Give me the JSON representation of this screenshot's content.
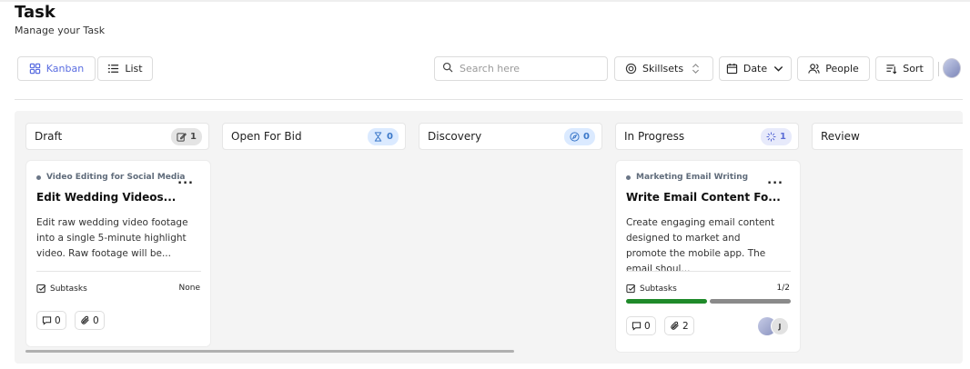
{
  "header": {
    "title": "Task",
    "subtitle": "Manage your Task"
  },
  "views": {
    "kanban_label": "Kanban",
    "list_label": "List",
    "active": "Kanban"
  },
  "toolbar": {
    "search_placeholder": "Search here",
    "skillsets_label": "Skillsets",
    "date_label": "Date",
    "people_label": "People",
    "sort_label": "Sort"
  },
  "columns": [
    {
      "name": "Draft",
      "count": "1",
      "badge_icon": "edit-icon"
    },
    {
      "name": "Open For Bid",
      "count": "0",
      "badge_icon": "hourglass-icon"
    },
    {
      "name": "Discovery",
      "count": "0",
      "badge_icon": "compass-icon"
    },
    {
      "name": "In Progress",
      "count": "1",
      "badge_icon": "loader-icon"
    },
    {
      "name": "Review"
    }
  ],
  "cards": {
    "draft": {
      "category": "Video Editing for Social Media",
      "title": "Edit Wedding Videos...",
      "description": "Edit raw wedding video footage into a single 5-minute highlight video. Raw footage will be...",
      "subtasks_label": "Subtasks",
      "subtasks_value": "None",
      "comments": "0",
      "attachments": "0"
    },
    "in_progress": {
      "category": "Marketing Email Writing",
      "title": "Write Email Content Fo...",
      "description": "Create engaging email content designed to market and promote the mobile app. The email shoul...",
      "subtasks_label": "Subtasks",
      "subtasks_value": "1/2",
      "subtasks_progress": 0.5,
      "comments": "0",
      "attachments": "2",
      "assignee_initial": "J"
    }
  },
  "colors": {
    "accent": "#5b6ee1",
    "progress_done": "#1f8a2a",
    "progress_todo": "#8a8a8a",
    "board_bg": "#f4f4f4"
  }
}
